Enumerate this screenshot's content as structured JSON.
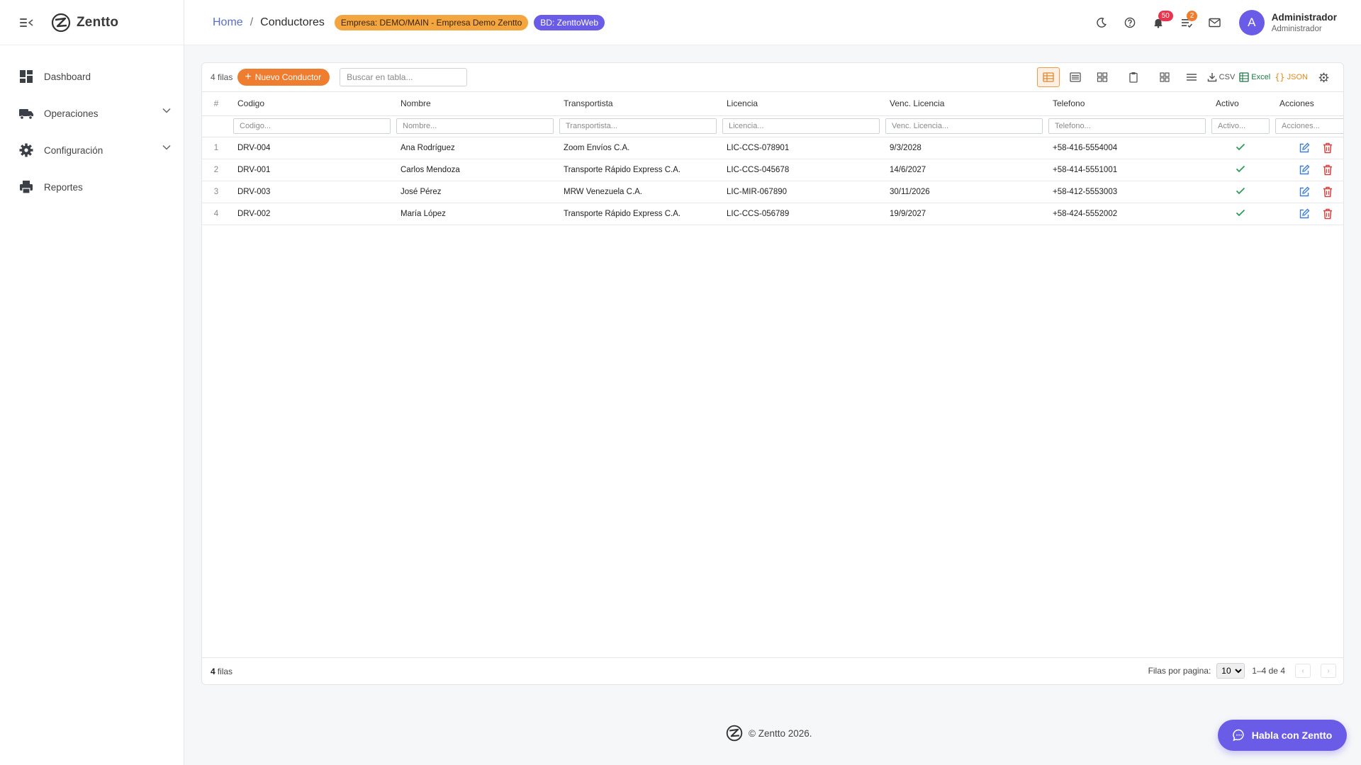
{
  "app": {
    "brand": "Zentto"
  },
  "sidebar": {
    "items": [
      {
        "label": "Dashboard",
        "icon": "dashboard-icon",
        "expandable": false
      },
      {
        "label": "Operaciones",
        "icon": "truck-icon",
        "expandable": true
      },
      {
        "label": "Configuración",
        "icon": "gear-icon",
        "expandable": true
      },
      {
        "label": "Reportes",
        "icon": "printer-icon",
        "expandable": false
      }
    ]
  },
  "header": {
    "breadcrumb_home": "Home",
    "breadcrumb_sep": "/",
    "breadcrumb_current": "Conductores",
    "empresa_badge": "Empresa: DEMO/MAIN - Empresa Demo Zentto",
    "db_badge": "BD: ZenttoWeb",
    "notifications_count": "50",
    "tasks_count": "2",
    "avatar_letter": "A",
    "user_name": "Administrador",
    "user_role": "Administrador"
  },
  "colors": {
    "accent": "#ee7d2f",
    "primary": "#6b5ce7",
    "notif_badge": "#e8344d",
    "tasks_badge": "#ee7d2f",
    "check": "#2e9c5a",
    "edit": "#3d7fd6",
    "delete": "#d84040"
  },
  "toolbar": {
    "rows_label": "4 filas",
    "new_button": "Nuevo Conductor",
    "search_placeholder": "Buscar en tabla...",
    "csv_label": "CSV",
    "excel_label": "Excel",
    "json_label": "JSON"
  },
  "table": {
    "num_header": "#",
    "columns": [
      "Codigo",
      "Nombre",
      "Transportista",
      "Licencia",
      "Venc. Licencia",
      "Telefono",
      "Activo",
      "Acciones"
    ],
    "filters": [
      "Codigo...",
      "Nombre...",
      "Transportista...",
      "Licencia...",
      "Venc. Licencia...",
      "Telefono...",
      "Activo...",
      "Acciones..."
    ],
    "rows": [
      {
        "n": "1",
        "codigo": "DRV-004",
        "nombre": "Ana Rodríguez",
        "transportista": "Zoom Envíos C.A.",
        "licencia": "LIC-CCS-078901",
        "venc": "9/3/2028",
        "telefono": "+58-416-5554004",
        "activo": true
      },
      {
        "n": "2",
        "codigo": "DRV-001",
        "nombre": "Carlos Mendoza",
        "transportista": "Transporte Rápido Express C.A.",
        "licencia": "LIC-CCS-045678",
        "venc": "14/6/2027",
        "telefono": "+58-414-5551001",
        "activo": true
      },
      {
        "n": "3",
        "codigo": "DRV-003",
        "nombre": "José Pérez",
        "transportista": "MRW Venezuela C.A.",
        "licencia": "LIC-MIR-067890",
        "venc": "30/11/2026",
        "telefono": "+58-412-5553003",
        "activo": true
      },
      {
        "n": "4",
        "codigo": "DRV-002",
        "nombre": "María López",
        "transportista": "Transporte Rápido Express C.A.",
        "licencia": "LIC-CCS-056789",
        "venc": "19/9/2027",
        "telefono": "+58-424-5552002",
        "activo": true
      }
    ]
  },
  "footer": {
    "rows_count": "4",
    "rows_word": "filas",
    "per_page_label": "Filas por pagina:",
    "per_page_value": "10",
    "range": "1–4 de 4",
    "prev": "‹",
    "next": "›"
  },
  "copyright": "© Zentto 2026.",
  "chat_button": "Habla con Zentto"
}
